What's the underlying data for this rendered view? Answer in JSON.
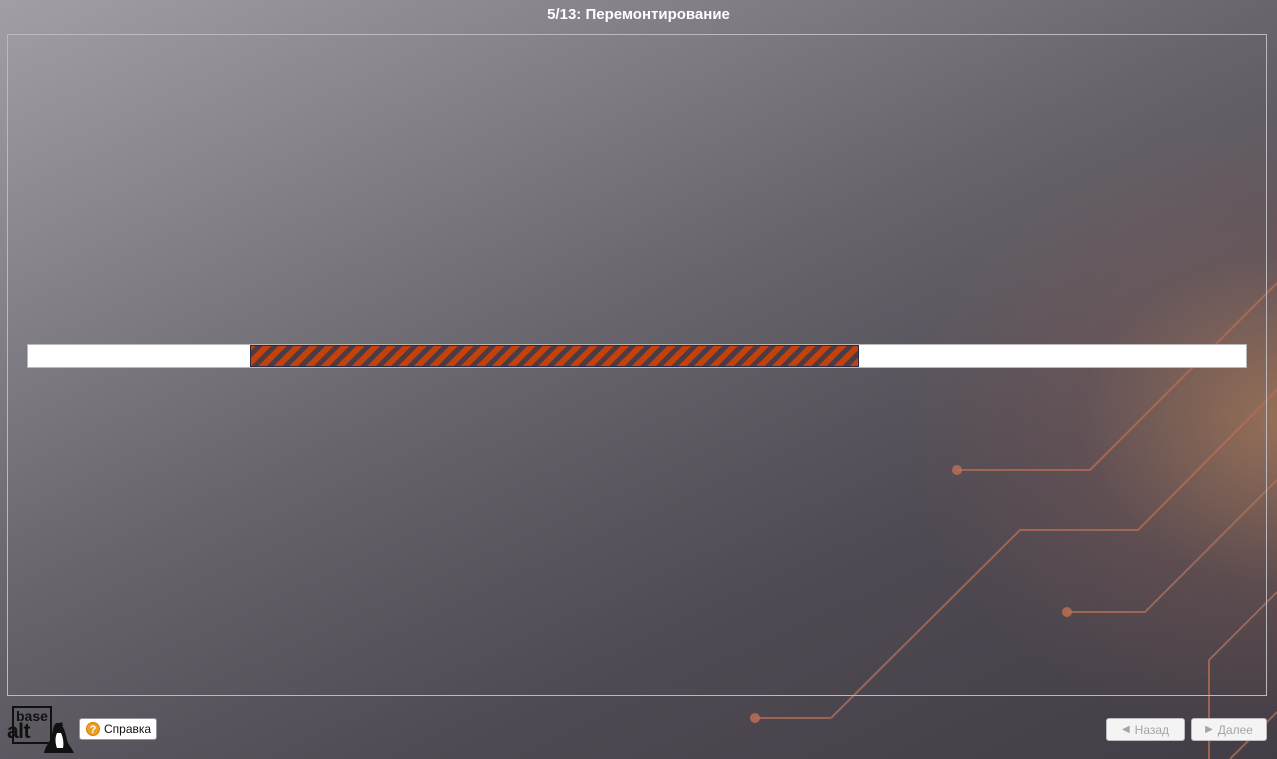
{
  "header": {
    "title": "5/13: Перемонтирование"
  },
  "progress": {
    "mode": "indeterminate"
  },
  "logo": {
    "text_top": "base",
    "text_bottom": "alt"
  },
  "footer": {
    "help_label": "Справка",
    "help_icon": "question-icon",
    "back_label": "Назад",
    "back_icon": "chevron-left-icon",
    "next_label": "Далее",
    "next_icon": "chevron-right-icon",
    "buttons_disabled": true
  },
  "colors": {
    "progress_stripe_orange": "#c4410c",
    "progress_stripe_dark": "#4a3b45",
    "accent_circuit": "#c77a55"
  }
}
